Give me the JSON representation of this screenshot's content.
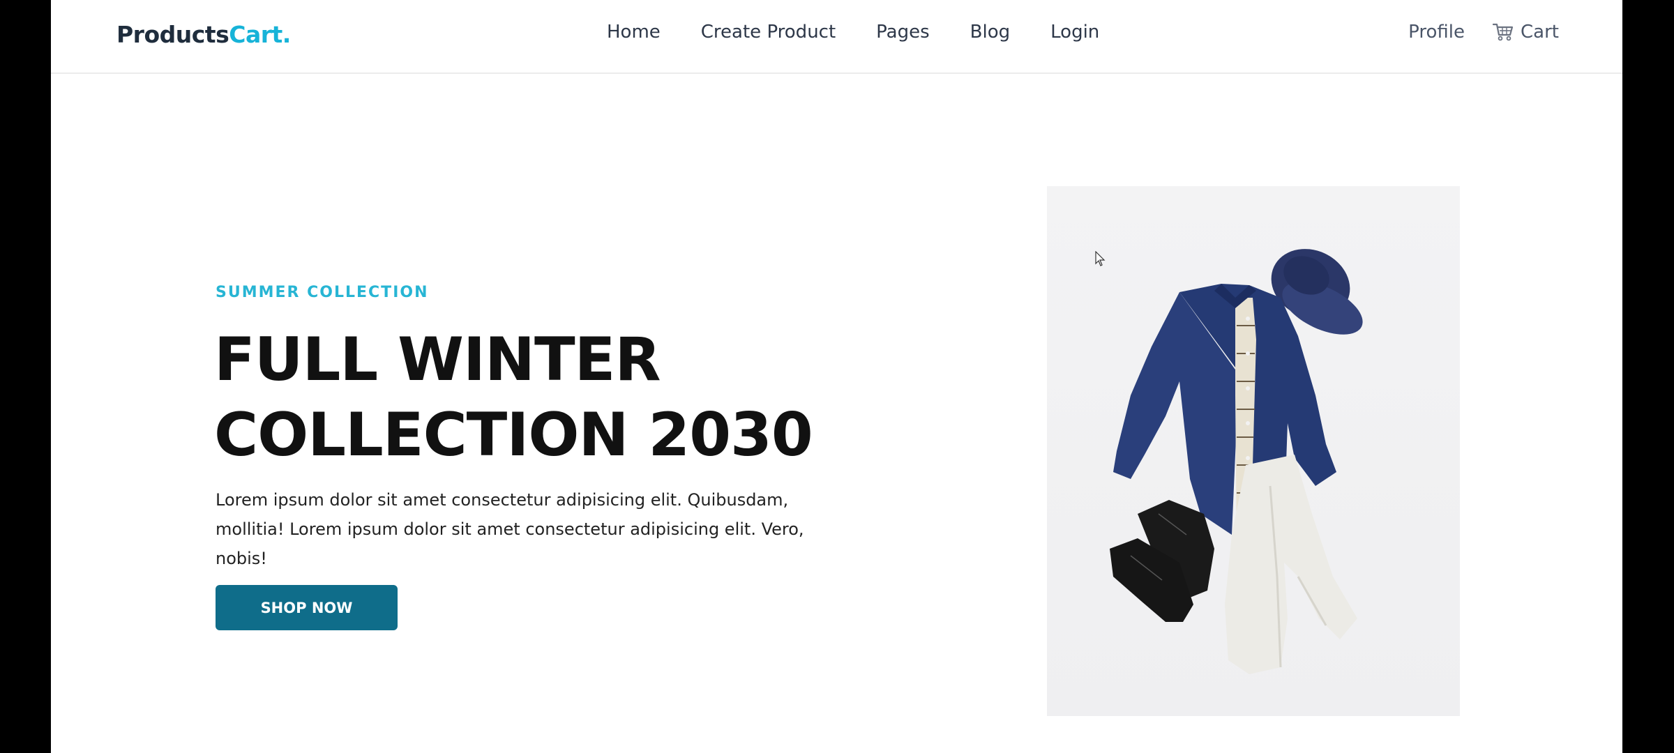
{
  "brand": {
    "part1": "Products",
    "part2": "Cart.",
    "color_primary": "#1f2d3d",
    "color_accent": "#17b3d8"
  },
  "nav": {
    "links": [
      {
        "label": "Home"
      },
      {
        "label": "Create Product"
      },
      {
        "label": "Pages"
      },
      {
        "label": "Blog"
      },
      {
        "label": "Login"
      }
    ],
    "profile_label": "Profile",
    "cart_label": "Cart",
    "cart_icon": "shopping-cart-icon"
  },
  "hero": {
    "eyebrow": "SUMMER COLLECTION",
    "headline_line1": "FULL WINTER",
    "headline_line2": "COLLECTION 2030",
    "description": "Lorem ipsum dolor sit amet consectetur adipisicing elit. Quibusdam, mollitia! Lorem ipsum dolor sit amet consectetur adipisicing elit. Vero, nobis!",
    "button_label": "SHOP NOW",
    "button_color": "#0f6d8a",
    "eyebrow_color": "#27b5d4"
  },
  "image": {
    "subject": "flat-lay-outfit-image"
  }
}
